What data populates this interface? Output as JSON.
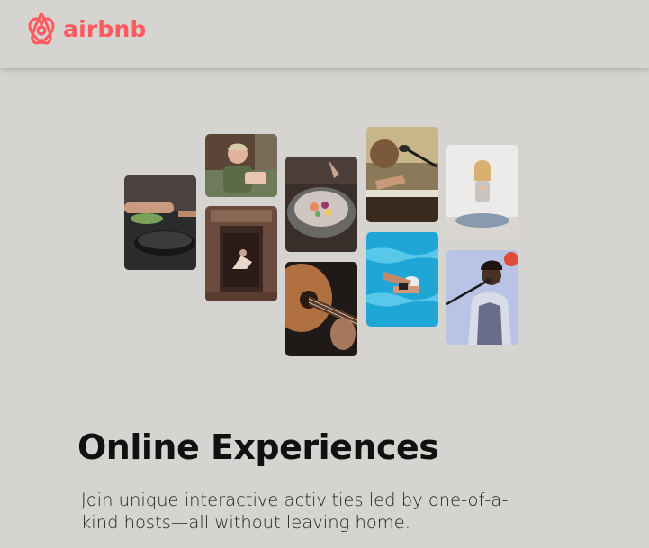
{
  "header": {
    "logo_text": "airbnb",
    "logo_icon": "airbnb-belo-icon",
    "brand_color": "#ff5a5f"
  },
  "hero": {
    "title": "Online Experiences",
    "subtitle": "Join unique interactive activities led by one-of-a-kind hosts—all without leaving home."
  },
  "gallery": {
    "photos": [
      {
        "name": "photo-cooking-pan"
      },
      {
        "name": "photo-chef-woman"
      },
      {
        "name": "photo-dancer-doorway"
      },
      {
        "name": "photo-food-bowl"
      },
      {
        "name": "photo-guitar"
      },
      {
        "name": "photo-singer-piano"
      },
      {
        "name": "photo-swimmer-pool"
      },
      {
        "name": "photo-yoga-woman"
      },
      {
        "name": "photo-singer-microphone"
      }
    ]
  }
}
